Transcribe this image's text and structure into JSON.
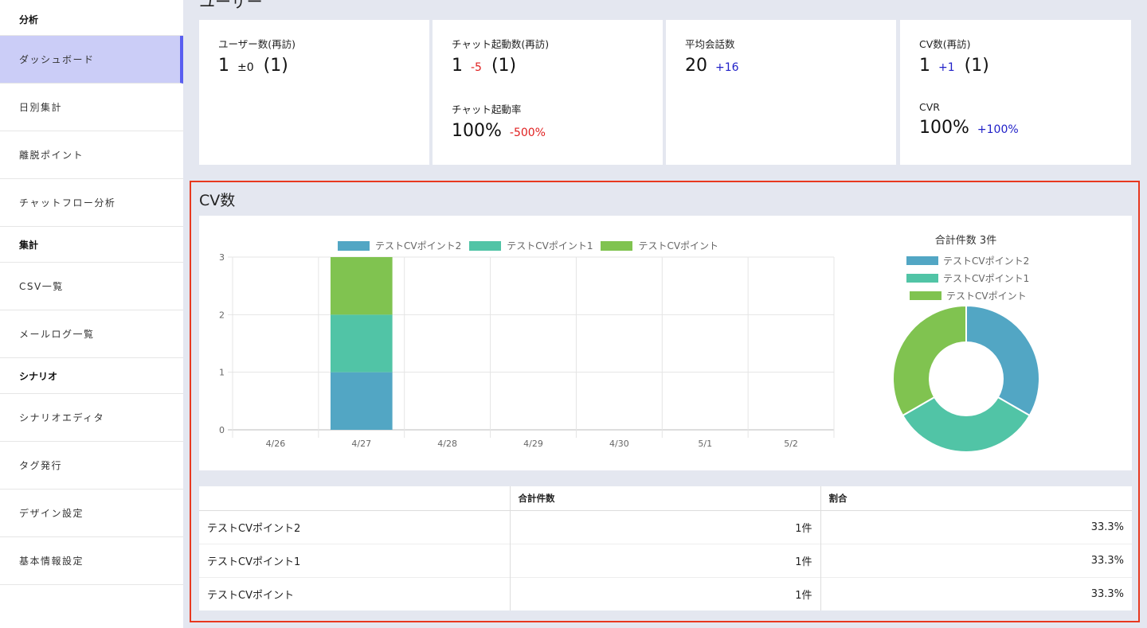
{
  "sidebar": {
    "sections": [
      {
        "head": "分析",
        "items": [
          "ダッシュボード",
          "日別集計",
          "離脱ポイント",
          "チャットフロー分析"
        ]
      },
      {
        "head": "集計",
        "items": [
          "CSV一覧",
          "メールログ一覧"
        ]
      },
      {
        "head": "シナリオ",
        "items": [
          "シナリオエディタ",
          "タグ発行",
          "デザイン設定",
          "基本情報設定"
        ]
      }
    ],
    "active": "ダッシュボード"
  },
  "page_title": "ユーザー",
  "stats": {
    "users": {
      "label": "ユーザー数(再訪)",
      "value": "1",
      "delta": "±0",
      "paren": "(1)"
    },
    "chat_starts": {
      "label": "チャット起動数(再訪)",
      "value": "1",
      "delta": "-5",
      "paren": "(1)"
    },
    "chat_rate": {
      "label": "チャット起動率",
      "value": "100%",
      "delta": "-500%"
    },
    "avg_talks": {
      "label": "平均会話数",
      "value": "20",
      "delta": "+16"
    },
    "cv": {
      "label": "CV数(再訪)",
      "value": "1",
      "delta": "+1",
      "paren": "(1)"
    },
    "cvr": {
      "label": "CVR",
      "value": "100%",
      "delta": "+100%"
    }
  },
  "cv_section": {
    "title": "CV数",
    "donut_title": "合計件数 3件",
    "table": {
      "headers": [
        "",
        "合計件数",
        "割合"
      ],
      "rows": [
        [
          "テストCVポイント2",
          "1件",
          "33.3%"
        ],
        [
          "テストCVポイント1",
          "1件",
          "33.3%"
        ],
        [
          "テストCVポイント",
          "1件",
          "33.3%"
        ]
      ]
    }
  },
  "colors": {
    "series1": "#52a6c4",
    "series2": "#51c4a6",
    "series3": "#80c350",
    "accent": "#5a5ff0",
    "highlight_border": "#e8381f"
  },
  "chart_data": [
    {
      "type": "bar",
      "stacked": true,
      "categories": [
        "4/26",
        "4/27",
        "4/28",
        "4/29",
        "4/30",
        "5/1",
        "5/2"
      ],
      "series": [
        {
          "name": "テストCVポイント2",
          "values": [
            0,
            1,
            0,
            0,
            0,
            0,
            0
          ]
        },
        {
          "name": "テストCVポイント1",
          "values": [
            0,
            1,
            0,
            0,
            0,
            0,
            0
          ]
        },
        {
          "name": "テストCVポイント",
          "values": [
            0,
            1,
            0,
            0,
            0,
            0,
            0
          ]
        }
      ],
      "yticks": [
        0,
        1,
        2,
        3
      ],
      "ylim": [
        0,
        3
      ],
      "grid": true,
      "legend": "top"
    },
    {
      "type": "pie",
      "donut": true,
      "labels": [
        "テストCVポイント2",
        "テストCVポイント1",
        "テストCVポイント"
      ],
      "values": [
        1,
        1,
        1
      ],
      "title": "合計件数 3件",
      "legend": "top"
    }
  ]
}
